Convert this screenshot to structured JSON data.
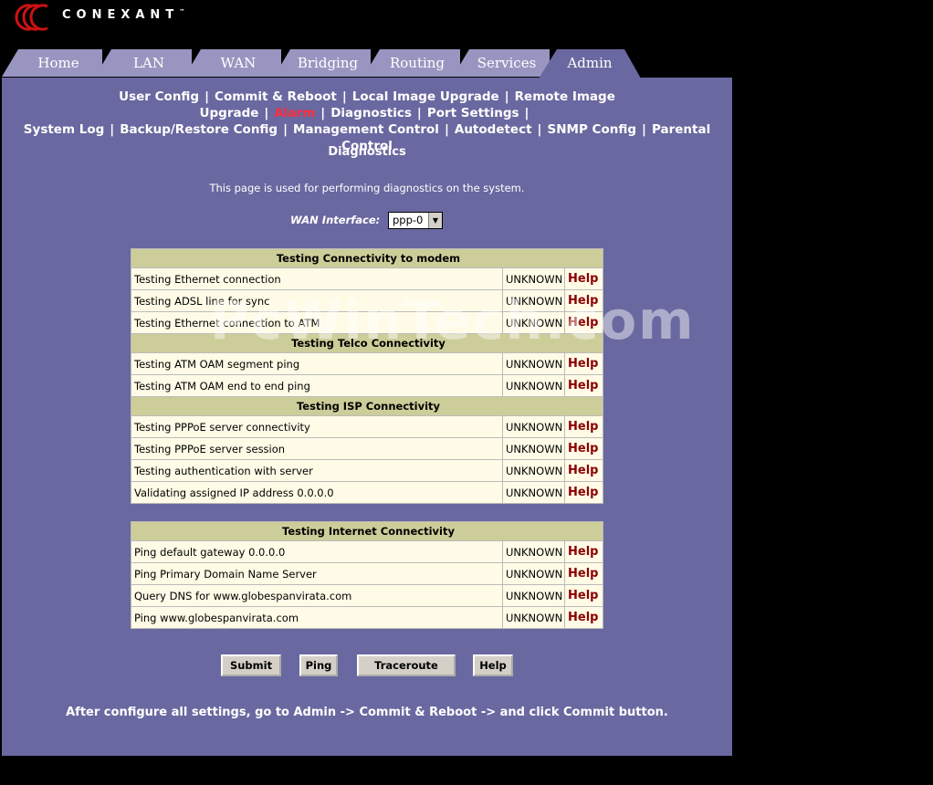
{
  "brand": {
    "name": "CONEXANT",
    "tm": "™"
  },
  "tabs": [
    "Home",
    "LAN",
    "WAN",
    "Bridging",
    "Routing",
    "Services",
    "Admin"
  ],
  "active_tab": "Admin",
  "subnav": {
    "row1": [
      "User Config",
      "Commit & Reboot",
      "Local Image Upgrade",
      "Remote Image Upgrade",
      "Alarm",
      "Diagnostics",
      "Port Settings"
    ],
    "row2": [
      "System Log",
      "Backup/Restore Config",
      "Management Control",
      "Autodetect",
      "SNMP Config",
      "Parental Control"
    ],
    "active": "Alarm"
  },
  "page": {
    "title": "Diagnostics",
    "description": "This page is used for performing diagnostics on the system.",
    "wan_label": "WAN Interface:",
    "wan_value": "ppp-0"
  },
  "table1": {
    "sec1": "Testing Connectivity to modem",
    "r1": "Testing Ethernet connection",
    "r2": "Testing ADSL line for sync",
    "r3": "Testing Ethernet connection to ATM",
    "sec2": "Testing Telco Connectivity",
    "r4": "Testing ATM OAM segment ping",
    "r5": "Testing ATM OAM end to end ping",
    "sec3": "Testing ISP Connectivity",
    "r6": "Testing PPPoE server connectivity",
    "r7": "Testing PPPoE server session",
    "r8": "Testing authentication with server",
    "r9": "Validating assigned IP address 0.0.0.0"
  },
  "table2": {
    "sec1": "Testing Internet Connectivity",
    "r1": "Ping default gateway 0.0.0.0",
    "r2": "Ping Primary Domain Name Server",
    "r3": "Query DNS for www.globespanvirata.com",
    "r4": "Ping www.globespanvirata.com"
  },
  "status": "UNKNOWN",
  "help": "Help",
  "buttons": {
    "submit": "Submit",
    "ping": "Ping",
    "traceroute": "Traceroute",
    "help": "Help"
  },
  "footer": "After configure all settings, go to Admin -> Commit & Reboot -> and click Commit button.",
  "watermark": "PcWinTech.com",
  "colors": {
    "panel": "#6a68a0",
    "tab": "#9896c0",
    "active_link": "#ff2d3a",
    "section": "#cdcd9a",
    "row": "#fffbe6"
  }
}
